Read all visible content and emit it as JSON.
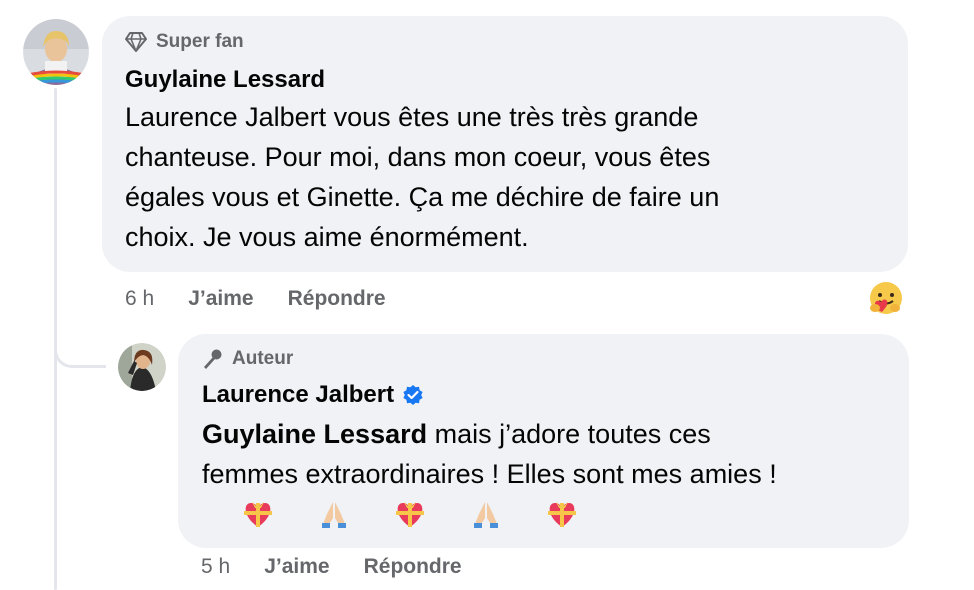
{
  "comment": {
    "badge": "Super fan",
    "author": "Guylaine Lessard",
    "text": "Laurence Jalbert vous êtes une très très grande\nchanteuse. Pour moi, dans mon coeur, vous êtes\négales vous et Ginette. Ça me déchire de faire un\nchoix. Je vous aime énormément.",
    "time": "6 h",
    "like_label": "J’aime",
    "reply_label": "Répondre",
    "badge_icon": "diamond-icon",
    "reaction_icon": "care-reaction-icon"
  },
  "reply": {
    "badge": "Auteur",
    "author": "Laurence Jalbert",
    "verified_icon": "verified-badge-icon",
    "badge_icon": "microphone-icon",
    "mention": "Guylaine Lessard",
    "text": " mais j’adore toutes ces\nfemmes extraordinaires ! Elles sont mes amies !",
    "emojis": [
      "💝",
      "🙏",
      "💝",
      "🙏",
      "💝"
    ],
    "time": "5 h",
    "like_label": "J’aime",
    "reply_label": "Répondre"
  },
  "colors": {
    "bubble": "#f0f2f5",
    "meta_text": "#65676b",
    "verified": "#1877f2"
  }
}
